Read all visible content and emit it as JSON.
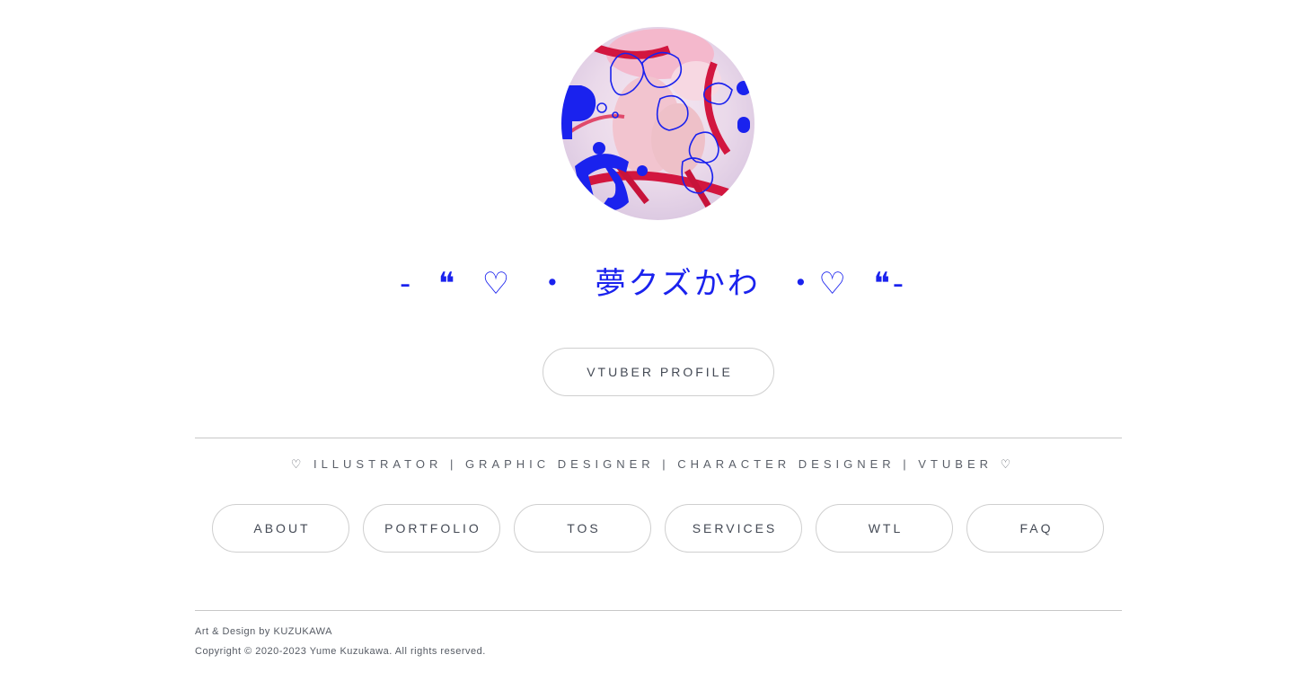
{
  "header": {
    "avatar_alt": "Yume Kuzukawa avatar",
    "title": "-  ❝  ♡  ・  夢クズかわ  ・♡  ❝-"
  },
  "profile_button": {
    "label": "VTUBER PROFILE"
  },
  "tagline": "♡ ILLUSTRATOR | GRAPHIC DESIGNER | CHARACTER DESIGNER | VTUBER ♡",
  "nav": {
    "items": [
      {
        "label": "ABOUT"
      },
      {
        "label": "PORTFOLIO"
      },
      {
        "label": "TOS"
      },
      {
        "label": "SERVICES"
      },
      {
        "label": "WTL"
      },
      {
        "label": "FAQ"
      }
    ]
  },
  "footer": {
    "credit": "Art & Design by KUZUKAWA",
    "copyright": "Copyright © 2020-2023 Yume Kuzukawa. All rights reserved."
  },
  "colors": {
    "accent": "#1a22ee",
    "border": "#cfcfcf",
    "divider": "#c8c8c8",
    "text": "#444a55"
  }
}
